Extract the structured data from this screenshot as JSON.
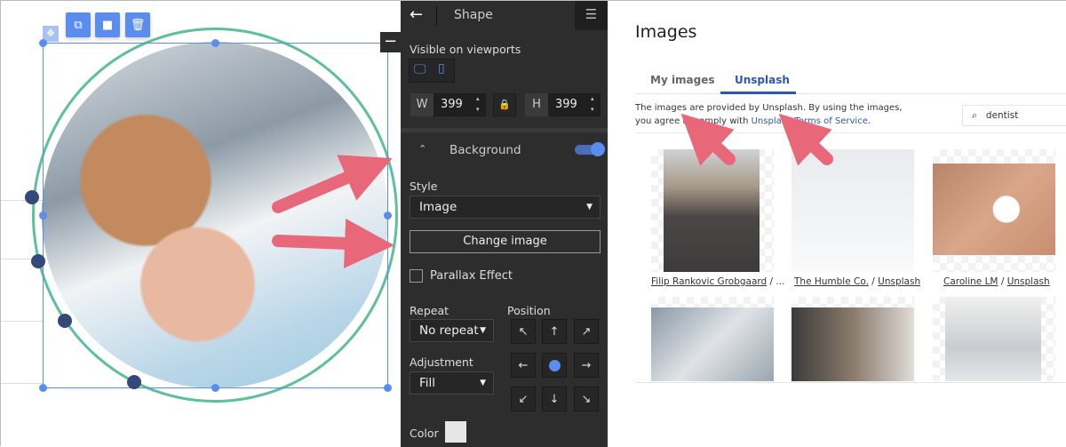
{
  "canvas": {
    "toolbar": {
      "move": "move-icon",
      "duplicate": "duplicate-icon",
      "arrange": "arrange-icon",
      "delete": "trash-icon"
    },
    "collapse_label": "−"
  },
  "panel": {
    "title": "Shape",
    "viewports_label": "Visible on viewports",
    "w_label": "W",
    "w_value": "399",
    "h_label": "H",
    "h_value": "399",
    "background_label": "Background",
    "background_enabled": true,
    "style_label": "Style",
    "style_value": "Image",
    "change_image": "Change image",
    "parallax_label": "Parallax Effect",
    "parallax_checked": false,
    "repeat_label": "Repeat",
    "repeat_value": "No repeat",
    "position_label": "Position",
    "adjustment_label": "Adjustment",
    "adjustment_value": "Fill",
    "color_label": "Color",
    "color_value": "#e6e6e6",
    "position_selected": "center",
    "accent": "#5b8def"
  },
  "images": {
    "title": "Images",
    "tabs": [
      {
        "label": "My images",
        "active": false
      },
      {
        "label": "Unsplash",
        "active": true
      }
    ],
    "notice_1": "The images are provided by Unsplash. By using the images,",
    "notice_2a": "you agree to comply with ",
    "notice_link": "Unsplash Terms of Service",
    ".": ".",
    "notice_end": ".",
    "search_value": "dentist",
    "results": [
      {
        "author": "Filip Rankovic Grobgaard",
        "source": "..."
      },
      {
        "author": "The Humble Co.",
        "source": "Unsplash"
      },
      {
        "author": "Caroline LM",
        "source": "Unsplash"
      }
    ]
  },
  "annotation_color": "#e8687a"
}
